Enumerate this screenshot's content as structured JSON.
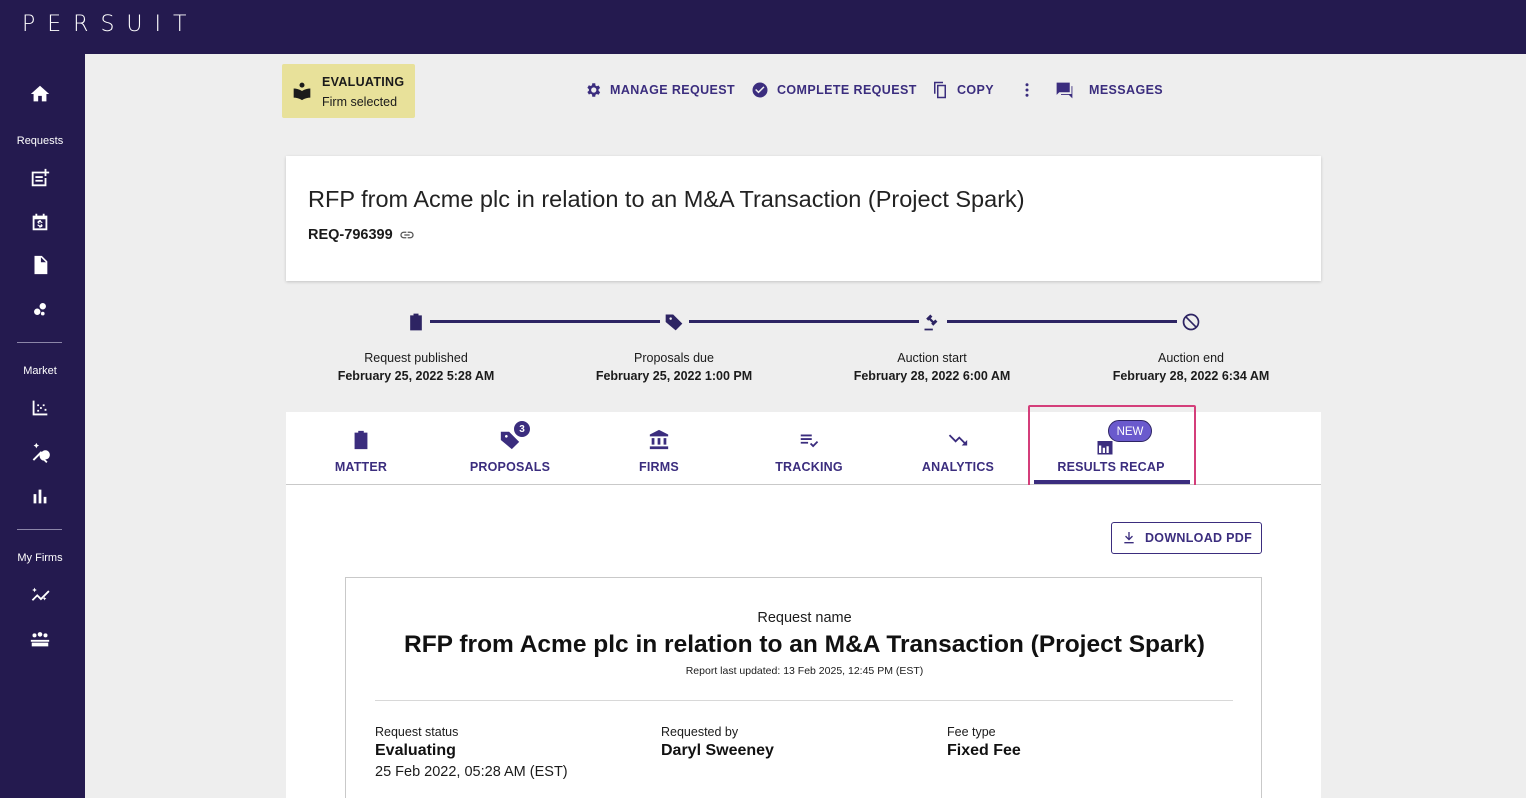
{
  "app": {
    "logo": "PERSUIT"
  },
  "sidebar": {
    "sections": [
      "Requests",
      "Market",
      "My Firms"
    ],
    "icons": [
      "home-icon",
      "new-request-icon",
      "calendar-dollar-icon",
      "document-icon",
      "scatter-icon",
      "market-chart-icon",
      "magic-search-icon",
      "bar-chart-icon",
      "analytics-wand-icon",
      "group-icon"
    ]
  },
  "status": {
    "title": "EVALUATING",
    "subtitle": "Firm selected"
  },
  "actions": {
    "manage": "MANAGE REQUEST",
    "complete": "COMPLETE REQUEST",
    "copy": "COPY",
    "messages": "MESSAGES"
  },
  "request": {
    "title": "RFP from Acme plc in relation to an M&A Transaction (Project Spark)",
    "id": "REQ-796399"
  },
  "timeline": [
    {
      "label": "Request published",
      "date": "February 25, 2022 5:28 AM"
    },
    {
      "label": "Proposals due",
      "date": "February 25, 2022 1:00 PM"
    },
    {
      "label": "Auction start",
      "date": "February 28, 2022 6:00 AM"
    },
    {
      "label": "Auction end",
      "date": "February 28, 2022 6:34 AM"
    }
  ],
  "tabs": [
    {
      "label": "MATTER"
    },
    {
      "label": "PROPOSALS",
      "badge": "3"
    },
    {
      "label": "FIRMS"
    },
    {
      "label": "TRACKING"
    },
    {
      "label": "ANALYTICS"
    },
    {
      "label": "RESULTS RECAP",
      "pill": "NEW"
    }
  ],
  "download": {
    "label": "DOWNLOAD PDF"
  },
  "report": {
    "name_label": "Request name",
    "name": "RFP from Acme plc in relation to an M&A Transaction (Project Spark)",
    "updated": "Report last updated: 13 Feb 2025, 12:45 PM (EST)",
    "fields": [
      {
        "key": "Request status",
        "value": "Evaluating",
        "sub": "25 Feb 2022, 05:28 AM (EST)"
      },
      {
        "key": "Requested by",
        "value": "Daryl Sweeney"
      },
      {
        "key": "Fee type",
        "value": "Fixed Fee"
      }
    ]
  },
  "colors": {
    "brand": "#241a4f",
    "accent": "#3b2d7e",
    "status_bg": "#e8e19a",
    "highlight": "#d43e7a"
  }
}
